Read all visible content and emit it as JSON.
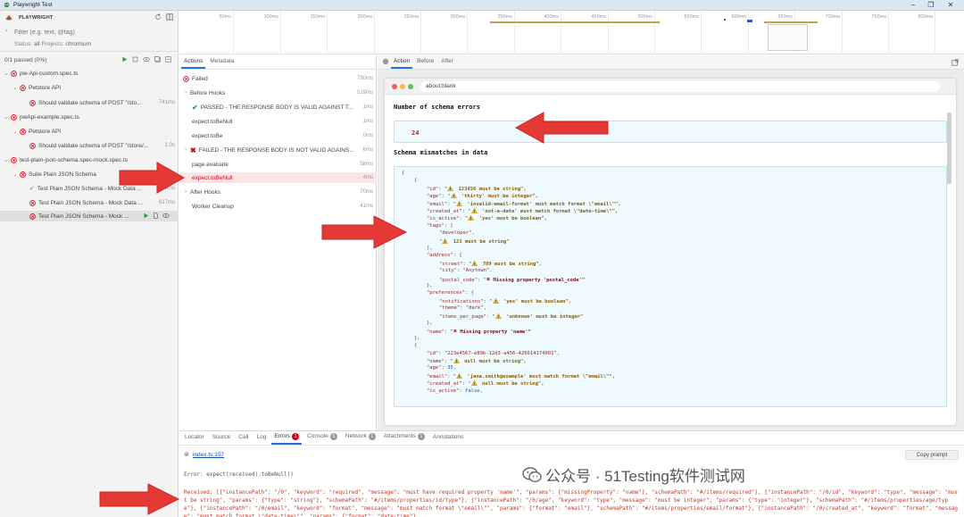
{
  "window": {
    "title": "Playwright Test"
  },
  "sidebar": {
    "brand": "PLAYWRIGHT",
    "filter_placeholder": "Filter (e.g. text, @tag)",
    "status_label": "Status:",
    "status_value": "all",
    "projects_label": "Projects:",
    "projects_value": "chromium",
    "passed_summary": "0/1 passed (0%)",
    "tree": [
      {
        "label": "pw-Api-custom.spec.ts",
        "duration": ""
      },
      {
        "label": "Petstore API",
        "duration": ""
      },
      {
        "label": "Should validate schema of POST \"/sto...",
        "duration": "741ms"
      },
      {
        "label": "pwApi-example.spec.ts",
        "duration": ""
      },
      {
        "label": "Petstore API",
        "duration": ""
      },
      {
        "label": "Should validate schema of POST \"/store/...",
        "duration": "1.0s"
      },
      {
        "label": "test-plain-json-schema.spec-mock.spec.ts",
        "duration": ""
      },
      {
        "label": "Suite Plain JSON Schema",
        "duration": ""
      },
      {
        "label": "Test Plain JSON Schema - Mock Data ...",
        "duration": "443ms"
      },
      {
        "label": "Test Plain JSON Schema - Mock Data ...",
        "duration": "617ms"
      },
      {
        "label": "Test Plain JSON Schema - Mock ...",
        "duration": ""
      }
    ]
  },
  "timeline": {
    "ticks": [
      "50ms",
      "100ms",
      "150ms",
      "200ms",
      "250ms",
      "300ms",
      "350ms",
      "400ms",
      "450ms",
      "500ms",
      "550ms",
      "600ms",
      "650ms",
      "700ms",
      "750ms",
      "800ms"
    ]
  },
  "actions_panel": {
    "tabs": [
      "Actions",
      "Metadata"
    ],
    "rows": [
      {
        "label": "Failed",
        "duration": "790ms"
      },
      {
        "label": "Before Hooks",
        "duration": "519ms"
      },
      {
        "label": "PASSED - THE RESPONSE BODY IS VALID AGAINST T...",
        "duration": "1ms"
      },
      {
        "label": "expect.toBeNull",
        "duration": "1ms"
      },
      {
        "label": "expect.toBe",
        "duration": "0ms"
      },
      {
        "label": "FAILED - THE RESPONSE BODY IS NOT VALID AGAINS...",
        "duration": "6ms"
      },
      {
        "label": "page.evaluate",
        "duration": "58ms"
      },
      {
        "label": "expect.toBeNull",
        "duration": "4ms"
      },
      {
        "label": "After Hooks",
        "duration": "70ms"
      },
      {
        "label": "Worker Cleanup",
        "duration": "41ms"
      }
    ]
  },
  "snapshot": {
    "tabs": [
      "Action",
      "Before",
      "After"
    ],
    "url": "about:blank",
    "errors_title": "Number of schema errors",
    "errors_count": "24",
    "mismatch_title": "Schema mismatches in data"
  },
  "json_lines": [
    {
      "indent": 0,
      "parts": [
        {
          "t": "p",
          "v": "{"
        }
      ]
    },
    {
      "indent": 1,
      "parts": [
        {
          "t": "p",
          "v": "{"
        }
      ]
    },
    {
      "indent": 2,
      "parts": [
        {
          "t": "k",
          "v": "\"id\""
        },
        {
          "t": "p",
          "v": ": \""
        },
        {
          "t": "warn"
        },
        {
          "t": "w",
          "v": " 123456 must be string\","
        }
      ]
    },
    {
      "indent": 2,
      "parts": [
        {
          "t": "k",
          "v": "\"age\""
        },
        {
          "t": "p",
          "v": ": \""
        },
        {
          "t": "warn"
        },
        {
          "t": "w",
          "v": " 'thirty' must be integer\","
        }
      ]
    },
    {
      "indent": 2,
      "parts": [
        {
          "t": "k",
          "v": "\"email\""
        },
        {
          "t": "p",
          "v": ": \""
        },
        {
          "t": "warn"
        },
        {
          "t": "w",
          "v": " 'invalid-email-format' must match format \\\"email\\\"\","
        }
      ]
    },
    {
      "indent": 2,
      "parts": [
        {
          "t": "k",
          "v": "\"created_at\""
        },
        {
          "t": "p",
          "v": ": \""
        },
        {
          "t": "warn"
        },
        {
          "t": "w",
          "v": " 'not-a-date' must match format \\\"date-time\\\"\","
        }
      ]
    },
    {
      "indent": 2,
      "parts": [
        {
          "t": "k",
          "v": "\"is_active\""
        },
        {
          "t": "p",
          "v": ": \""
        },
        {
          "t": "warn"
        },
        {
          "t": "w",
          "v": " 'yes' must be boolean\","
        }
      ]
    },
    {
      "indent": 2,
      "parts": [
        {
          "t": "k",
          "v": "\"tags\""
        },
        {
          "t": "p",
          "v": ": ["
        }
      ]
    },
    {
      "indent": 3,
      "parts": [
        {
          "t": "k",
          "v": "\"developer\""
        },
        {
          "t": "p",
          "v": ","
        }
      ]
    },
    {
      "indent": 3,
      "parts": [
        {
          "t": "p",
          "v": "\""
        },
        {
          "t": "warn"
        },
        {
          "t": "w",
          "v": " 123 must be string\""
        }
      ]
    },
    {
      "indent": 2,
      "parts": [
        {
          "t": "p",
          "v": "],"
        }
      ]
    },
    {
      "indent": 2,
      "parts": [
        {
          "t": "k",
          "v": "\"address\""
        },
        {
          "t": "p",
          "v": ": {"
        }
      ]
    },
    {
      "indent": 3,
      "parts": [
        {
          "t": "k",
          "v": "\"street\""
        },
        {
          "t": "p",
          "v": ": \""
        },
        {
          "t": "warn"
        },
        {
          "t": "w",
          "v": " 789 must be string\","
        }
      ]
    },
    {
      "indent": 3,
      "parts": [
        {
          "t": "k",
          "v": "\"city\""
        },
        {
          "t": "p",
          "v": ": "
        },
        {
          "t": "k",
          "v": "\"Anytown\""
        },
        {
          "t": "p",
          "v": ","
        }
      ]
    },
    {
      "indent": 3,
      "parts": [
        {
          "t": "k",
          "v": "\"postal_code\""
        },
        {
          "t": "p",
          "v": ": \""
        },
        {
          "t": "cross"
        },
        {
          "t": "e",
          "v": " Missing property 'postal_code'\""
        }
      ]
    },
    {
      "indent": 2,
      "parts": [
        {
          "t": "p",
          "v": "},"
        }
      ]
    },
    {
      "indent": 2,
      "parts": [
        {
          "t": "k",
          "v": "\"preferences\""
        },
        {
          "t": "p",
          "v": ": {"
        }
      ]
    },
    {
      "indent": 3,
      "parts": [
        {
          "t": "k",
          "v": "\"notifications\""
        },
        {
          "t": "p",
          "v": ": \""
        },
        {
          "t": "warn"
        },
        {
          "t": "w",
          "v": " 'yes' must be boolean\","
        }
      ]
    },
    {
      "indent": 3,
      "parts": [
        {
          "t": "k",
          "v": "\"theme\""
        },
        {
          "t": "p",
          "v": ": "
        },
        {
          "t": "k",
          "v": "\"dark\""
        },
        {
          "t": "p",
          "v": ","
        }
      ]
    },
    {
      "indent": 3,
      "parts": [
        {
          "t": "k",
          "v": "\"items_per_page\""
        },
        {
          "t": "p",
          "v": ": \""
        },
        {
          "t": "warn"
        },
        {
          "t": "w",
          "v": " 'unknown' must be integer\""
        }
      ]
    },
    {
      "indent": 2,
      "parts": [
        {
          "t": "p",
          "v": "},"
        }
      ]
    },
    {
      "indent": 2,
      "parts": [
        {
          "t": "k",
          "v": "\"name\""
        },
        {
          "t": "p",
          "v": ": \""
        },
        {
          "t": "cross"
        },
        {
          "t": "e",
          "v": " Missing property 'name'\""
        }
      ]
    },
    {
      "indent": 1,
      "parts": [
        {
          "t": "p",
          "v": "},"
        }
      ]
    },
    {
      "indent": 1,
      "parts": [
        {
          "t": "p",
          "v": "{"
        }
      ]
    },
    {
      "indent": 2,
      "parts": [
        {
          "t": "k",
          "v": "\"id\""
        },
        {
          "t": "p",
          "v": ": "
        },
        {
          "t": "k",
          "v": "\"223e4567-e89b-12d3-a456-426614174001\""
        },
        {
          "t": "p",
          "v": ","
        }
      ]
    },
    {
      "indent": 2,
      "parts": [
        {
          "t": "k",
          "v": "\"name\""
        },
        {
          "t": "p",
          "v": ": \""
        },
        {
          "t": "warn"
        },
        {
          "t": "w",
          "v": " null must be string\","
        }
      ]
    },
    {
      "indent": 2,
      "parts": [
        {
          "t": "k",
          "v": "\"age\""
        },
        {
          "t": "p",
          "v": ": "
        },
        {
          "t": "n",
          "v": "35"
        },
        {
          "t": "p",
          "v": ","
        }
      ]
    },
    {
      "indent": 2,
      "parts": [
        {
          "t": "k",
          "v": "\"email\""
        },
        {
          "t": "p",
          "v": ": \""
        },
        {
          "t": "warn"
        },
        {
          "t": "w",
          "v": " 'jane.smith@example' must match format \\\"email\\\"\","
        }
      ]
    },
    {
      "indent": 2,
      "parts": [
        {
          "t": "k",
          "v": "\"created_at\""
        },
        {
          "t": "p",
          "v": ": \""
        },
        {
          "t": "warn"
        },
        {
          "t": "w",
          "v": " null must be string\","
        }
      ]
    },
    {
      "indent": 2,
      "parts": [
        {
          "t": "k",
          "v": "\"is_active\""
        },
        {
          "t": "p",
          "v": ": "
        },
        {
          "t": "n",
          "v": "false"
        },
        {
          "t": "p",
          "v": ","
        }
      ]
    }
  ],
  "bottom_panel": {
    "tabs": [
      {
        "label": "Locator",
        "badge": ""
      },
      {
        "label": "Source",
        "badge": ""
      },
      {
        "label": "Call",
        "badge": ""
      },
      {
        "label": "Log",
        "badge": ""
      },
      {
        "label": "Errors",
        "badge": "1"
      },
      {
        "label": "Console",
        "badge": "5"
      },
      {
        "label": "Network",
        "badge": "1"
      },
      {
        "label": "Attachments",
        "badge": "1"
      },
      {
        "label": "Annotations",
        "badge": ""
      }
    ],
    "file_link": "index.ts:157",
    "copy_prompt": "Copy prompt",
    "error_line": "Error: expect(received).toBeNull()",
    "received": "Received: [{\"instancePath\": \"/0\", \"keyword\": \"required\", \"message\": \"must have required property 'name'\", \"params\": {\"missingProperty\": \"name\"}, \"schemaPath\": \"#/items/required\"}, {\"instancePath\": \"/0/id\", \"keyword\": \"type\", \"message\": \"must be string\", \"params\": {\"type\": \"string\"}, \"schemaPath\": \"#/items/properties/id/type\"}, {\"instancePath\": \"/0/age\", \"keyword\": \"type\", \"message\": \"must be integer\", \"params\": {\"type\": \"integer\"}, \"schemaPath\": \"#/items/properties/age/type\"}, {\"instancePath\": \"/0/email\", \"keyword\": \"format\", \"message\": \"must match format \\\"email\\\"\", \"params\": {\"format\": \"email\"}, \"schemaPath\": \"#/items/properties/email/format\"}, {\"instancePath\": \"/0/created_at\", \"keyword\": \"format\", \"message\": \"must match format \\\"date-time\\\"\", \"params\": {\"format\": \"date-time\"}"
  },
  "watermark": {
    "text": "公众号 · 51Testing软件测试网"
  },
  "colors": {
    "accent": "#1a73e8",
    "error": "#d0021b",
    "pass": "#2e9e44",
    "arrow": "#e53935",
    "selected": "#fde4e6"
  }
}
